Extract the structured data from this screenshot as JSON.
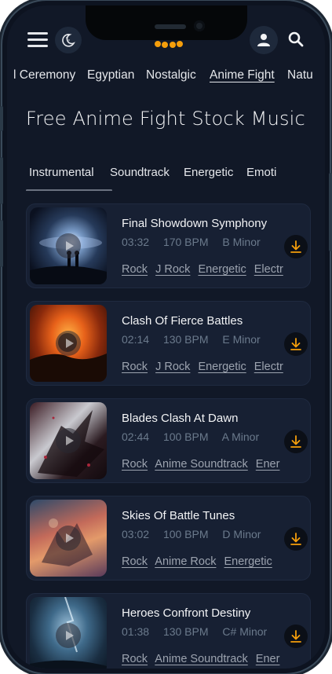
{
  "header": {
    "menu_icon": "hamburger-icon",
    "theme_icon": "moon-stars-icon",
    "logo_icon": "paw-logo-icon",
    "user_icon": "user-icon",
    "search_icon": "search-icon"
  },
  "categories": [
    {
      "label": "l Ceremony",
      "active": false
    },
    {
      "label": "Egyptian",
      "active": false
    },
    {
      "label": "Nostalgic",
      "active": false
    },
    {
      "label": "Anime Fight",
      "active": true
    },
    {
      "label": "Natu",
      "active": false
    }
  ],
  "page": {
    "title": "Free Anime Fight Stock Music"
  },
  "tabs": [
    {
      "label": "Instrumental",
      "active": true
    },
    {
      "label": "Soundtrack",
      "active": false
    },
    {
      "label": "Energetic",
      "active": false
    },
    {
      "label": "Emoti",
      "active": false
    }
  ],
  "tracks": [
    {
      "title": "Final Showdown Symphony",
      "duration": "03:32",
      "bpm": "170 BPM",
      "key": "B Minor",
      "tags": [
        "Rock",
        "J Rock",
        "Energetic",
        "Electr"
      ]
    },
    {
      "title": "Clash Of Fierce Battles",
      "duration": "02:14",
      "bpm": "130 BPM",
      "key": "E Minor",
      "tags": [
        "Rock",
        "J Rock",
        "Energetic",
        "Electr"
      ]
    },
    {
      "title": "Blades Clash At Dawn",
      "duration": "02:44",
      "bpm": "100 BPM",
      "key": "A Minor",
      "tags": [
        "Rock",
        "Anime Soundtrack",
        "Ener"
      ]
    },
    {
      "title": "Skies Of Battle Tunes",
      "duration": "03:02",
      "bpm": "100 BPM",
      "key": "D Minor",
      "tags": [
        "Rock",
        "Anime Rock",
        "Energetic"
      ]
    },
    {
      "title": "Heroes Confront Destiny",
      "duration": "01:38",
      "bpm": "130 BPM",
      "key": "C# Minor",
      "tags": [
        "Rock",
        "Anime Soundtrack",
        "Ener"
      ]
    }
  ],
  "colors": {
    "background": "#111827",
    "card": "#172033",
    "accent": "#f59e0b",
    "text": "#f3f4f6",
    "muted": "#6b7a8c"
  }
}
